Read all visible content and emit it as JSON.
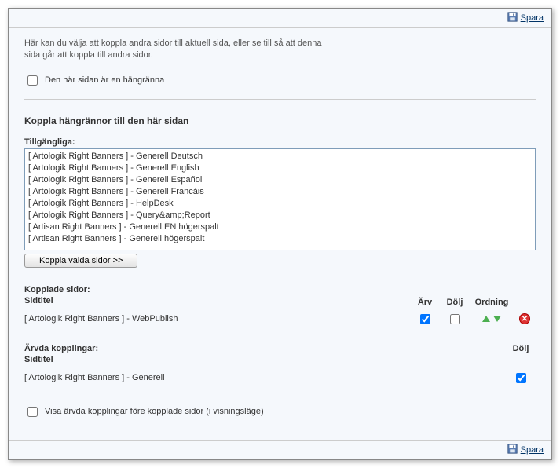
{
  "toolbar": {
    "save_label": "Spara"
  },
  "intro": {
    "text": "Här kan du välja att koppla andra sidor till aktuell sida, eller se till så att denna sida går att koppla till andra sidor."
  },
  "gutter_checkbox": {
    "label": "Den här sidan är en hängränna",
    "checked": false
  },
  "section": {
    "title": "Koppla hängrännor till den här sidan"
  },
  "available": {
    "label": "Tillgängliga:",
    "items": [
      "[ Artologik Right Banners ] - Generell Deutsch",
      "[ Artologik Right Banners ] - Generell English",
      "[ Artologik Right Banners ] - Generell Español",
      "[ Artologik Right Banners ] - Generell Francáis",
      "[ Artologik Right Banners ] - HelpDesk",
      "[ Artologik Right Banners ] - Query&amp;Report",
      "[ Artisan Right Banners ] - Generell EN högerspalt",
      "[ Artisan Right Banners ] - Generell högerspalt"
    ],
    "link_button": "Koppla valda sidor >>"
  },
  "linked": {
    "heading": "Kopplade sidor:",
    "col_title": "Sidtitel",
    "col_arv": "Ärv",
    "col_dolj": "Dölj",
    "col_ordning": "Ordning",
    "rows": [
      {
        "title": "[ Artologik Right Banners ] - WebPublish",
        "arv": true,
        "dolj": false
      }
    ]
  },
  "inherited": {
    "heading": "Ärvda kopplingar:",
    "col_title": "Sidtitel",
    "col_dolj": "Dölj",
    "rows": [
      {
        "title": "[ Artologik Right Banners ] - Generell",
        "dolj": true
      }
    ]
  },
  "footer_checkbox": {
    "label": "Visa ärvda kopplingar före kopplade sidor (i visningsläge)",
    "checked": false
  }
}
